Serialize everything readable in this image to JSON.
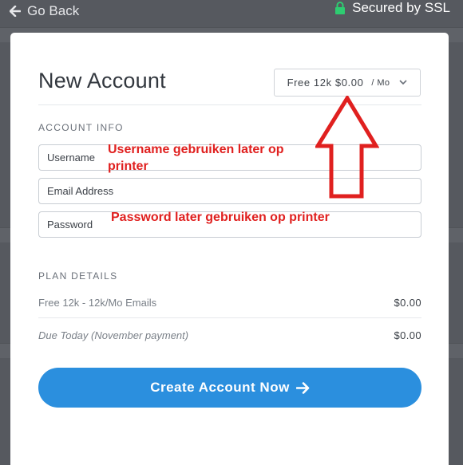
{
  "topbar": {
    "go_back": "Go Back",
    "secure": "Secured by SSL"
  },
  "card": {
    "title": "New Account",
    "plan_select": {
      "value": "Free 12k $0.00",
      "period": "/ Mo"
    },
    "account_info": {
      "heading": "ACCOUNT INFO",
      "username_placeholder": "Username",
      "email_placeholder": "Email Address",
      "password_placeholder": "Password"
    },
    "plan_details": {
      "heading": "PLAN DETAILS",
      "rows": [
        {
          "label": "Free 12k - 12k/Mo Emails",
          "value": "$0.00"
        },
        {
          "label": "Due Today (November payment)",
          "value": "$0.00"
        }
      ]
    },
    "cta_label": "Create Account Now"
  },
  "annotations": {
    "username_note_line1": "Username gebruiken later op",
    "username_note_line2": "printer",
    "password_note": "Password later gebruiken op printer",
    "color": "#e0201f"
  },
  "colors": {
    "accent": "#2b8fde",
    "lock": "#2ecc71"
  },
  "icons": [
    "arrow-left-icon",
    "lock-icon",
    "chevron-down-icon",
    "arrow-right-icon",
    "red-up-arrow-icon"
  ]
}
